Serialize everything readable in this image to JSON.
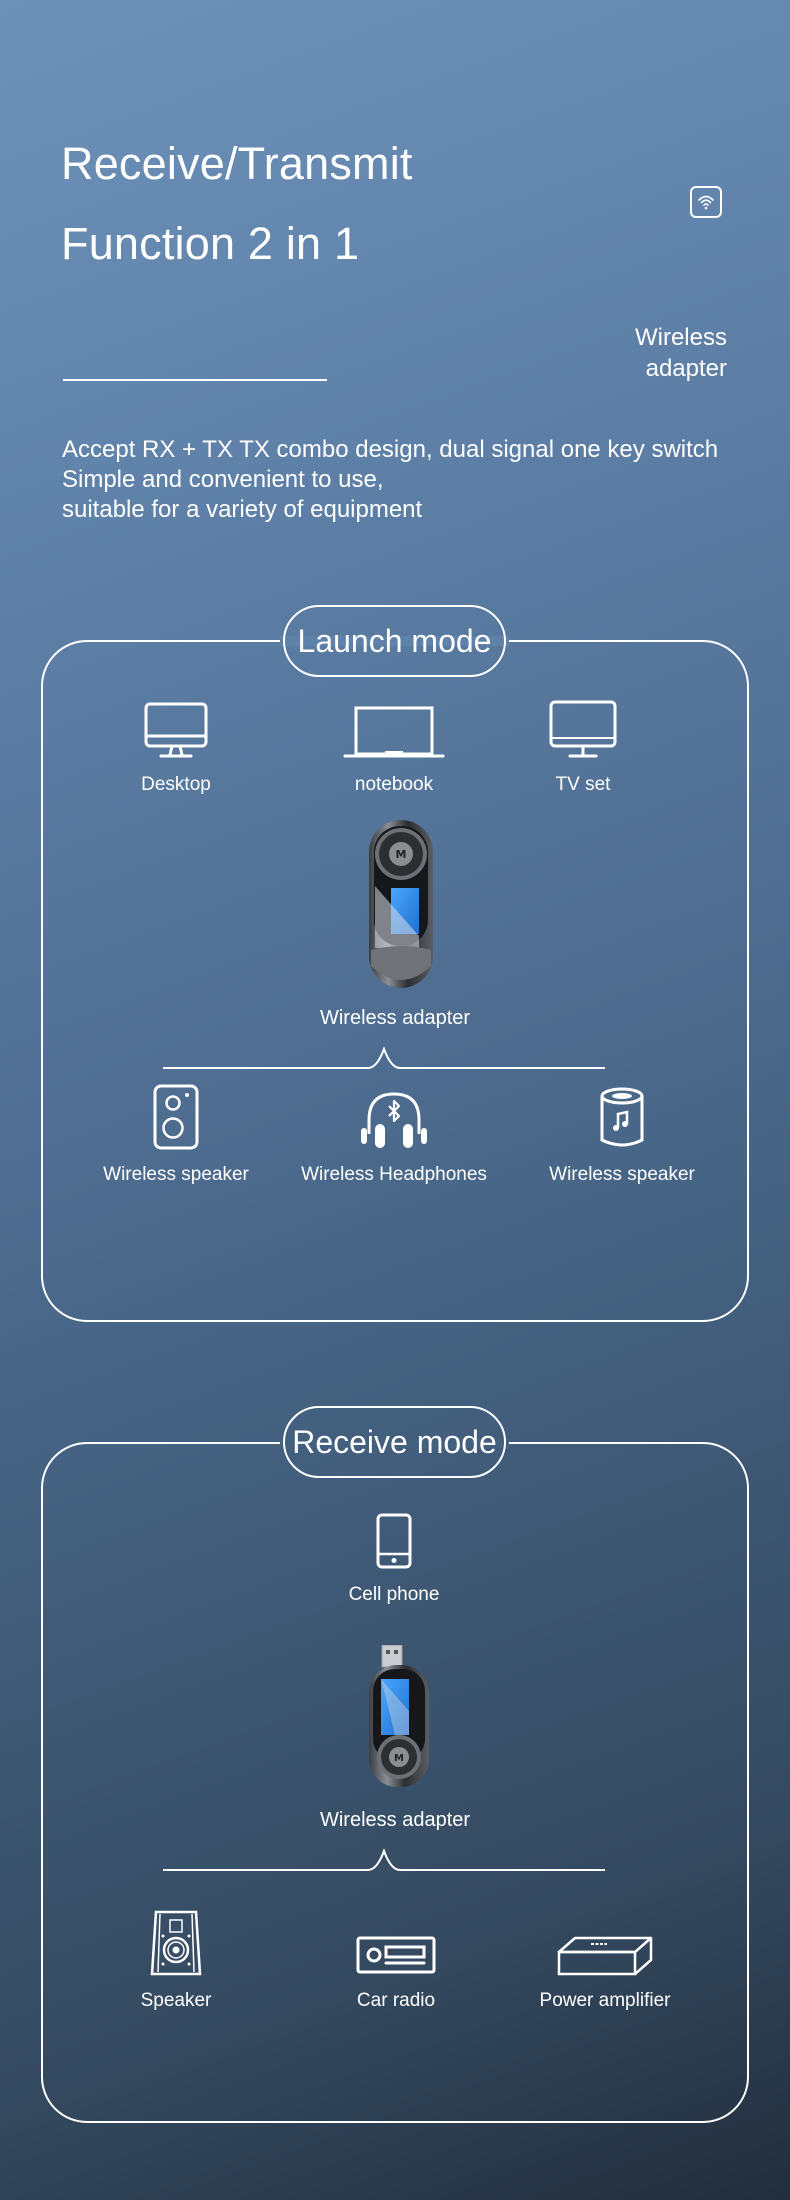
{
  "header": {
    "title_line1": "Receive/Transmit",
    "title_line2": "Function 2 in 1",
    "badge_icon": "wifi-icon",
    "side_label_line1": "Wireless",
    "side_label_line2": "adapter"
  },
  "description": [
    "Accept RX + TX TX combo design, dual signal one key switch",
    "Simple and convenient to use,",
    "suitable for a variety of equipment"
  ],
  "launch_mode": {
    "title": "Launch mode",
    "sources": [
      {
        "label": "Desktop",
        "icon": "desktop-monitor-icon"
      },
      {
        "label": "notebook",
        "icon": "laptop-icon"
      },
      {
        "label": "TV set",
        "icon": "tv-icon"
      }
    ],
    "adapter_label": "Wireless adapter",
    "targets": [
      {
        "label": "Wireless speaker",
        "icon": "speaker-cabinet-icon"
      },
      {
        "label": "Wireless Headphones",
        "icon": "bluetooth-headphones-icon"
      },
      {
        "label": "Wireless speaker",
        "icon": "cylinder-speaker-icon"
      }
    ]
  },
  "receive_mode": {
    "title": "Receive mode",
    "source": {
      "label": "Cell phone",
      "icon": "cell-phone-icon"
    },
    "adapter_label": "Wireless adapter",
    "targets": [
      {
        "label": "Speaker",
        "icon": "bookshelf-speaker-icon"
      },
      {
        "label": "Car radio",
        "icon": "car-radio-icon"
      },
      {
        "label": "Power amplifier",
        "icon": "power-amplifier-icon"
      }
    ]
  },
  "colors": {
    "accent": "#ffffff",
    "bg_top": "#6d91b9",
    "bg_bottom": "#222e3c",
    "lcd_blue": "#2f8de8"
  }
}
